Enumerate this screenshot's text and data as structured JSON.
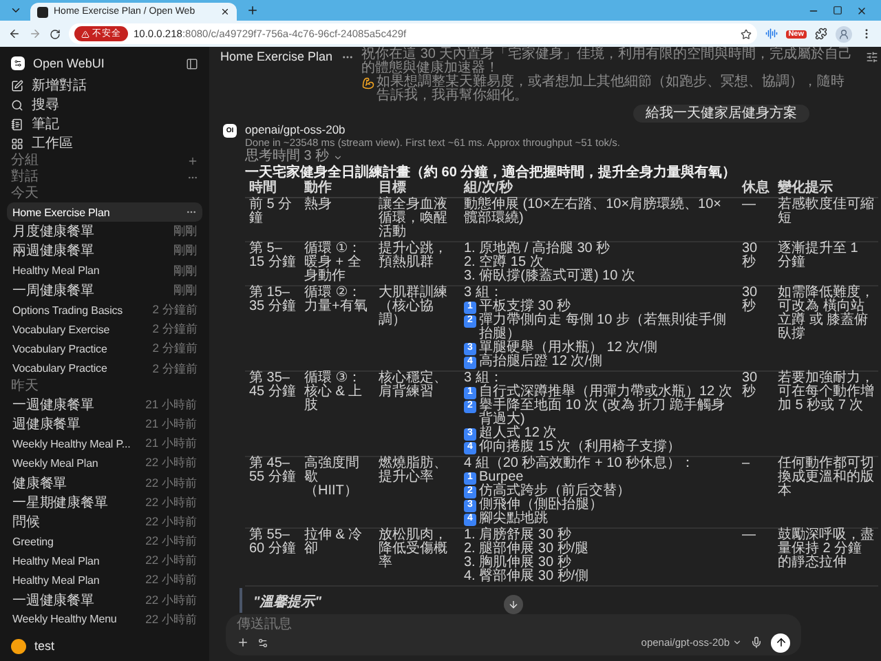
{
  "browser": {
    "tab_title": "Home Exercise Plan / Open Web",
    "security_label": "不安全",
    "url_host": "10.0.0.218",
    "url_path": ":8080/c/a49729f7-756a-4c76-96cf-24085a5c429f",
    "extension_badge": "New"
  },
  "sidebar": {
    "brand": "Open WebUI",
    "nav": [
      {
        "kind": "new",
        "label": "新增對話"
      },
      {
        "kind": "search",
        "label": "搜尋"
      },
      {
        "kind": "notes",
        "label": "筆記"
      },
      {
        "kind": "workspace",
        "label": "工作區"
      }
    ],
    "folders_label": "分組",
    "chats_label": "對話",
    "groups": [
      {
        "heading": "今天",
        "items": [
          {
            "title": "Home Exercise Plan",
            "selected": true
          },
          {
            "title": "月度健康餐單",
            "time": "剛剛",
            "selected": false
          },
          {
            "title": "兩週健康餐單",
            "time": "剛剛",
            "selected": false
          },
          {
            "title": "Healthy Meal Plan",
            "time": "剛剛",
            "selected": false
          },
          {
            "title": "一周健康餐單",
            "time": "剛剛",
            "selected": false
          },
          {
            "title": "Options Trading Basics",
            "time": "2 分鐘前",
            "selected": false
          },
          {
            "title": "Vocabulary Exercise",
            "time": "2 分鐘前",
            "selected": false
          },
          {
            "title": "Vocabulary Practice",
            "time": "2 分鐘前",
            "selected": false
          },
          {
            "title": "Vocabulary Practice",
            "time": "2 分鐘前",
            "selected": false
          }
        ]
      },
      {
        "heading": "昨天",
        "items": [
          {
            "title": "一週健康餐單",
            "time": "21 小時前",
            "selected": false
          },
          {
            "title": "週健康餐單",
            "time": "21 小時前",
            "selected": false
          },
          {
            "title": "Weekly Healthy Meal P...",
            "time": "21 小時前",
            "selected": false
          },
          {
            "title": "Weekly Meal Plan",
            "time": "22 小時前",
            "selected": false
          },
          {
            "title": "健康餐單",
            "time": "22 小時前",
            "selected": false
          },
          {
            "title": "一星期健康餐單",
            "time": "22 小時前",
            "selected": false
          },
          {
            "title": "問候",
            "time": "22 小時前",
            "selected": false
          },
          {
            "title": "Greeting",
            "time": "22 小時前",
            "selected": false
          },
          {
            "title": "Healthy Meal Plan",
            "time": "22 小時前",
            "selected": false
          },
          {
            "title": "Healthy Meal Plan",
            "time": "22 小時前",
            "selected": false
          },
          {
            "title": "一週健康餐單",
            "time": "22 小時前",
            "selected": false
          },
          {
            "title": "Weekly Healthy Menu",
            "time": "22 小時前",
            "selected": false
          }
        ]
      }
    ],
    "user": {
      "name": "test"
    }
  },
  "chat": {
    "title": "Home Exercise Plan",
    "intro_before": "祝你在這 30 天內置身「宅家健身」佳境，利用有限的空間與時間，完成屬於自己的體態與健康加速器！",
    "intro_after": "如果想調整某天難易度，或者想加上其他細節（如跑步、冥想、協調），隨時告訴我，我再幫你細化。",
    "user_message": "給我一天健家居健身方案",
    "model_badge": "OI",
    "model": "openai/gpt-oss-20b",
    "stats": "Done in ~23548 ms (stream view). First text ~61 ms. Approx throughput ~51 tok/s.",
    "thinking": "思考時間 3 秒",
    "heading": "一天宅家健身全日訓練計畫（約 60 分鐘，適合把握時間，提升全身力量與有氧）",
    "table": {
      "columns": [
        "時間",
        "動作",
        "目標",
        "組/次/秒",
        "休息",
        "變化提示"
      ],
      "rows": [
        {
          "time": "前 5 分鐘",
          "action": "熱身",
          "goal": "讓全身血液循環，喚醒活動",
          "sets": [
            {
              "kind": "text",
              "text": "動態伸展 (10×左右踏、10×肩膀環繞、10×髖部環繞)"
            }
          ],
          "rest": "—",
          "tip": "若感軟度佳可縮短"
        },
        {
          "time": "第 5–15 分鐘",
          "action": "循環 ①：暖身 + 全身動作",
          "goal": "提升心跳，預熱肌群",
          "sets": [
            {
              "kind": "text",
              "text": "1. 原地跑 / 高抬腿 30 秒"
            },
            {
              "kind": "text",
              "text": "2. 空蹲 15 次"
            },
            {
              "kind": "text",
              "text": "3. 俯臥撐(膝蓋式可選) 10 次"
            }
          ],
          "rest": "30 秒",
          "tip": "逐漸提升至 1 分鐘"
        },
        {
          "time": "第 15–35 分鐘",
          "action": "循環 ②：力量+有氧",
          "goal": "大肌群訓練（核心協調）",
          "sets": [
            {
              "kind": "text",
              "text": "3 組："
            },
            {
              "kind": "keycap",
              "num": "1",
              "text": "平板支撐 30 秒"
            },
            {
              "kind": "keycap",
              "num": "2",
              "text": "彈力帶側向走 每側 10 步（若無則徒手側抬腿）"
            },
            {
              "kind": "keycap",
              "num": "3",
              "text": "單腿硬舉（用水瓶） 12 次/側"
            },
            {
              "kind": "keycap",
              "num": "4",
              "text": "高抬腿后蹬 12 次/側"
            }
          ],
          "rest": "30 秒",
          "tip": "如需降低難度，可改為 橫向站立蹲 或 膝蓋俯臥撐"
        },
        {
          "time": "第 35–45 分鐘",
          "action": "循環 ③：核心 & 上肢",
          "goal": "核心穩定、肩背練習",
          "sets": [
            {
              "kind": "text",
              "text": "3 組："
            },
            {
              "kind": "keycap",
              "num": "1",
              "text": "自行式深蹲推舉（用彈力帶或水瓶）12 次"
            },
            {
              "kind": "keycap",
              "num": "2",
              "text": "擧手降至地面 10 次 (改為 折刀 跪手觸身背過大)"
            },
            {
              "kind": "keycap",
              "num": "3",
              "text": "超人式 12 次"
            },
            {
              "kind": "keycap",
              "num": "4",
              "text": "仰向捲腹 15 次（利用椅子支撐）"
            }
          ],
          "rest": "30 秒",
          "tip": "若要加強耐力，可在每个動作增加 5 秒或 7 次"
        },
        {
          "time": "第 45–55 分鐘",
          "action": "高強度間歇（HIIT）",
          "goal": "燃燒脂肪、提升心率",
          "sets": [
            {
              "kind": "text",
              "text": "4 組（20 秒高效動作 + 10 秒休息）："
            },
            {
              "kind": "keycap",
              "num": "1",
              "text": "Burpee"
            },
            {
              "kind": "keycap",
              "num": "2",
              "text": "仿高式跨步（前后交替）"
            },
            {
              "kind": "keycap",
              "num": "3",
              "text": "側飛伸（側卧抬腿）"
            },
            {
              "kind": "keycap",
              "num": "4",
              "text": "腳尖點地跳"
            }
          ],
          "rest": "–",
          "tip": "任何動作都可切換成更溫和的版本"
        },
        {
          "time": "第 55–60 分鐘",
          "action": "拉伸 & 冷卻",
          "goal": "放松肌肉，降低受傷概率",
          "sets": [
            {
              "kind": "text",
              "text": "1. 肩膀舒展 30 秒"
            },
            {
              "kind": "text",
              "text": "2. 腿部伸展 30 秒/腿"
            },
            {
              "kind": "text",
              "text": "3. 胸肌伸展 30 秒"
            },
            {
              "kind": "text",
              "text": "4. 臀部伸展 30 秒/側"
            }
          ],
          "rest": "—",
          "tip": "鼓勵深呼吸，盡量保持 2 分鐘的靜态拉伸"
        }
      ]
    },
    "blockquote": "\"溫馨提示\"",
    "input": {
      "placeholder": "傳送訊息",
      "model": "openai/gpt-oss-20b"
    }
  }
}
